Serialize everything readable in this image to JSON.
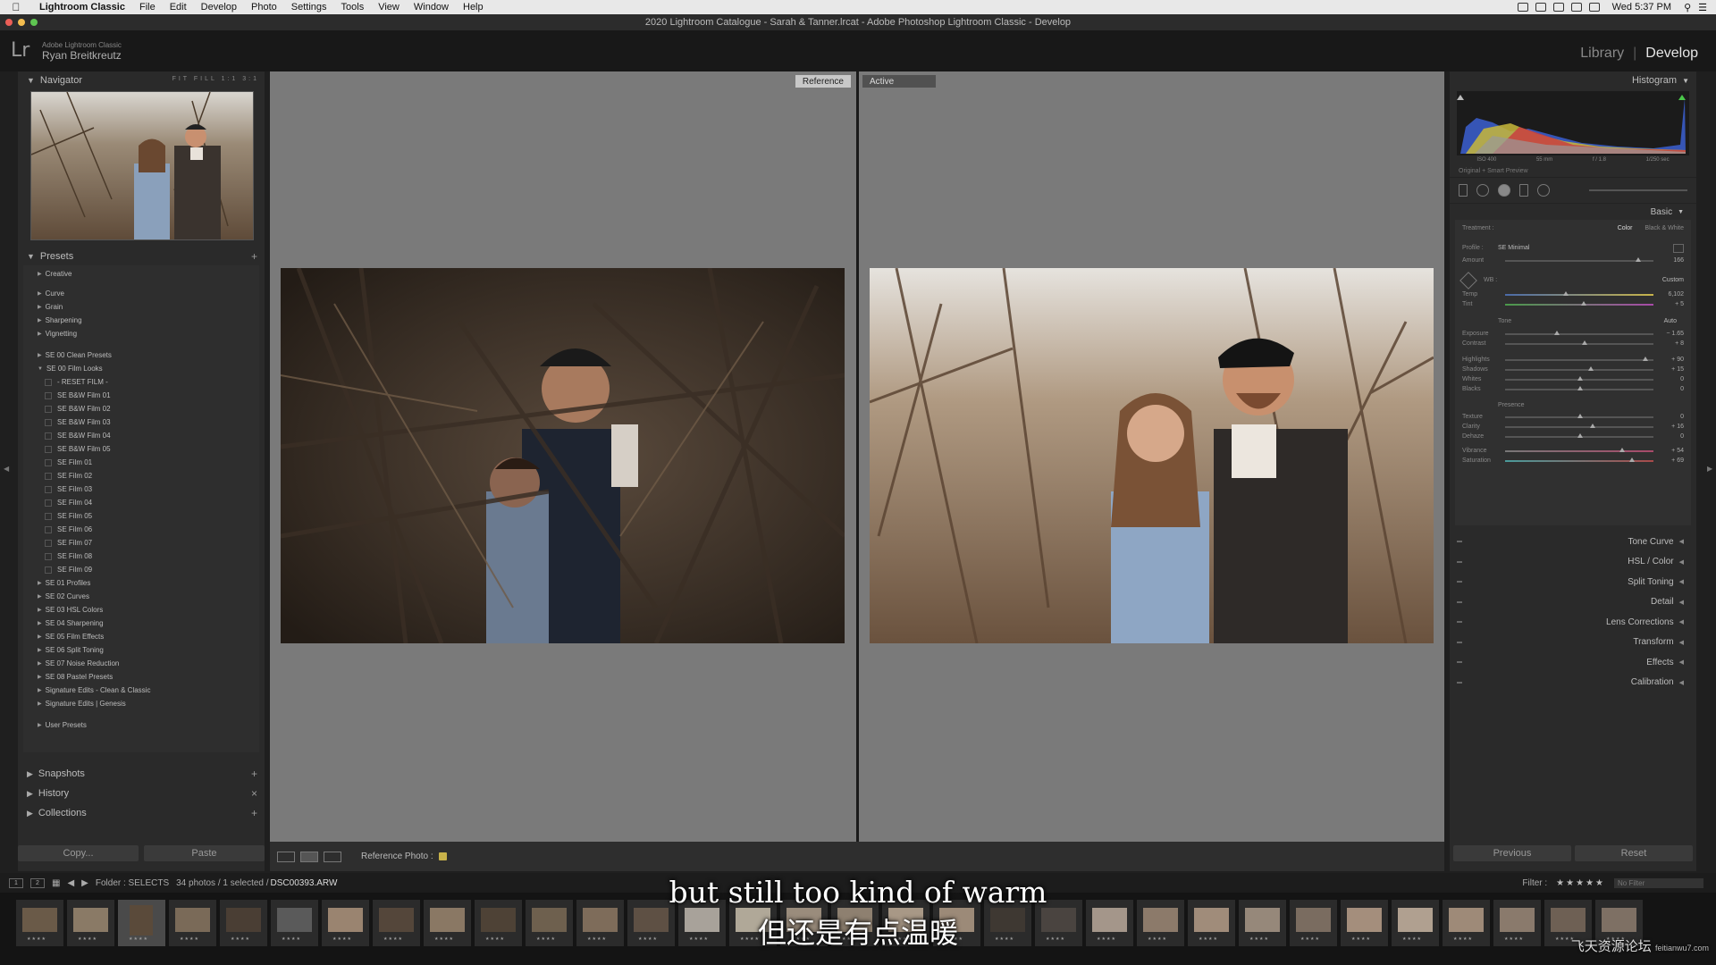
{
  "menubar": {
    "app": "Lightroom Classic",
    "items": [
      "File",
      "Edit",
      "Develop",
      "Photo",
      "Settings",
      "Tools",
      "View",
      "Window",
      "Help"
    ],
    "clock": "Wed 5:37 PM"
  },
  "window": {
    "title": "2020 Lightroom Catalogue - Sarah & Tanner.lrcat - Adobe Photoshop Lightroom Classic - Develop"
  },
  "identity": {
    "logo": "Lr",
    "sub": "Adobe Lightroom Classic",
    "user": "Ryan Breitkreutz",
    "modules": {
      "library": "Library",
      "sep": "|",
      "develop": "Develop"
    }
  },
  "left": {
    "navigator": "Navigator",
    "zoom": "FIT FILL 1:1 3:1",
    "presets": "Presets",
    "preset_items": {
      "creative": "Creative",
      "curve": "Curve",
      "grain": "Grain",
      "sharpening": "Sharpening",
      "vignetting": "Vignetting",
      "clean": "SE 00 Clean Presets",
      "film_looks": "SE 00 Film Looks",
      "film": [
        "- RESET FILM -",
        "SE B&W Film 01",
        "SE B&W Film 02",
        "SE B&W Film 03",
        "SE B&W Film 04",
        "SE B&W Film 05",
        "SE Film 01",
        "SE Film 02",
        "SE Film 03",
        "SE Film 04",
        "SE Film 05",
        "SE Film 06",
        "SE Film 07",
        "SE Film 08",
        "SE Film 09"
      ],
      "groups": [
        "SE 01 Profiles",
        "SE 02 Curves",
        "SE 03 HSL Colors",
        "SE 04 Sharpening",
        "SE 05 Film Effects",
        "SE 06 Split Toning",
        "SE 07 Noise Reduction",
        "SE 08 Pastel Presets",
        "Signature Edits - Clean & Classic",
        "Signature Edits | Genesis"
      ],
      "user": "User Presets"
    },
    "snapshots": "Snapshots",
    "history": "History",
    "collections": "Collections",
    "copy": "Copy...",
    "paste": "Paste"
  },
  "center": {
    "reference_tag": "Reference",
    "active_tag": "Active",
    "reference_photo_label": "Reference Photo :"
  },
  "right": {
    "histogram": "Histogram",
    "hist_info": [
      "ISO 400",
      "55 mm",
      "f / 1.8",
      "1/250 sec"
    ],
    "smart_preview": "Original + Smart Preview",
    "basic": "Basic",
    "treatment": "Treatment :",
    "color": "Color",
    "bw": "Black & White",
    "profile_label": "Profile :",
    "profile_value": "SE Minimal",
    "amount": {
      "label": "Amount",
      "value": "166"
    },
    "wb_label": "WB :",
    "wb_value": "Custom",
    "temp": {
      "label": "Temp",
      "value": "6,102"
    },
    "tint": {
      "label": "Tint",
      "value": "+ 5"
    },
    "tone_label": "Tone",
    "auto": "Auto",
    "tone": [
      {
        "label": "Exposure",
        "value": "− 1.65"
      },
      {
        "label": "Contrast",
        "value": "+ 8"
      },
      {
        "label": "Highlights",
        "value": "+ 90"
      },
      {
        "label": "Shadows",
        "value": "+ 15"
      },
      {
        "label": "Whites",
        "value": "0"
      },
      {
        "label": "Blacks",
        "value": "0"
      }
    ],
    "presence_label": "Presence",
    "presence": [
      {
        "label": "Texture",
        "value": "0"
      },
      {
        "label": "Clarity",
        "value": "+ 16"
      },
      {
        "label": "Dehaze",
        "value": "0"
      },
      {
        "label": "Vibrance",
        "value": "+ 54"
      },
      {
        "label": "Saturation",
        "value": "+ 69"
      }
    ],
    "panels": [
      "Tone Curve",
      "HSL / Color",
      "Split Toning",
      "Detail",
      "Lens Corrections",
      "Transform",
      "Effects",
      "Calibration"
    ],
    "previous": "Previous",
    "reset": "Reset"
  },
  "filmbar": {
    "view1": "1",
    "view2": "2",
    "folder": "Folder : SELECTS",
    "count": "34 photos / 1 selected /",
    "file": "DSC00393.ARW",
    "filter": "Filter :",
    "stars": "★★★★★",
    "no_filter": "No Filter"
  },
  "subtitles": {
    "en": "but still too kind of warm",
    "zh": "但还是有点温暖"
  },
  "watermark": {
    "main": "飞天资源论坛",
    "url": "feitianwu7.com"
  },
  "colors": {
    "panel": "#2a2a2a",
    "center": "#7a7a7a",
    "accent": "#c8b24a"
  }
}
